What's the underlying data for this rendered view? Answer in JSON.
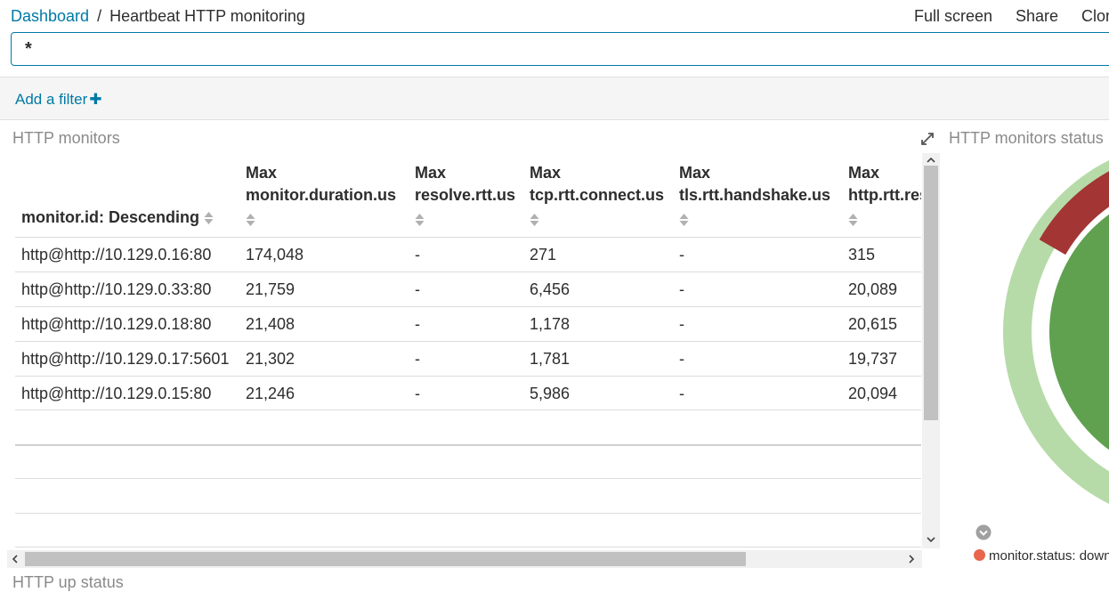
{
  "breadcrumb": {
    "root": "Dashboard",
    "separator": "/",
    "current": "Heartbeat HTTP monitoring"
  },
  "top_menu": {
    "full_screen": "Full screen",
    "share": "Share",
    "clone": "Clone"
  },
  "query": {
    "value": "*"
  },
  "filter_bar": {
    "add_filter": "Add a filter",
    "plus": "✚"
  },
  "panels": {
    "monitors_title": "HTTP monitors",
    "status_title": "HTTP monitors status",
    "up_status_title": "HTTP up status"
  },
  "table": {
    "columns": [
      {
        "line1": "",
        "line2": "monitor.id: Descending"
      },
      {
        "line1": "Max",
        "line2": "monitor.duration.us"
      },
      {
        "line1": "Max",
        "line2": "resolve.rtt.us"
      },
      {
        "line1": "Max",
        "line2": "tcp.rtt.connect.us"
      },
      {
        "line1": "Max",
        "line2": "tls.rtt.handshake.us"
      },
      {
        "line1": "Max",
        "line2": "http.rtt.response_header.us"
      }
    ],
    "rows": [
      [
        "http@http://10.129.0.16:80",
        "174,048",
        "-",
        "271",
        "-",
        "315"
      ],
      [
        "http@http://10.129.0.33:80",
        "21,759",
        "-",
        "6,456",
        "-",
        "20,089"
      ],
      [
        "http@http://10.129.0.18:80",
        "21,408",
        "-",
        "1,178",
        "-",
        "20,615"
      ],
      [
        "http@http://10.129.0.17:5601",
        "21,302",
        "-",
        "1,781",
        "-",
        "19,737"
      ],
      [
        "http@http://10.129.0.15:80",
        "21,246",
        "-",
        "5,986",
        "-",
        "20,094"
      ]
    ]
  },
  "legend": {
    "item": "monitor.status: down",
    "color": "#e7664c"
  },
  "colors": {
    "accent": "#0079a5",
    "up_dark": "#5fa14f",
    "up_light": "#b6dba9",
    "down": "#a33535"
  },
  "icons": {
    "sort": "sort-icon",
    "expand": "expand-icon",
    "legend_toggle": "chevron-down-icon"
  }
}
